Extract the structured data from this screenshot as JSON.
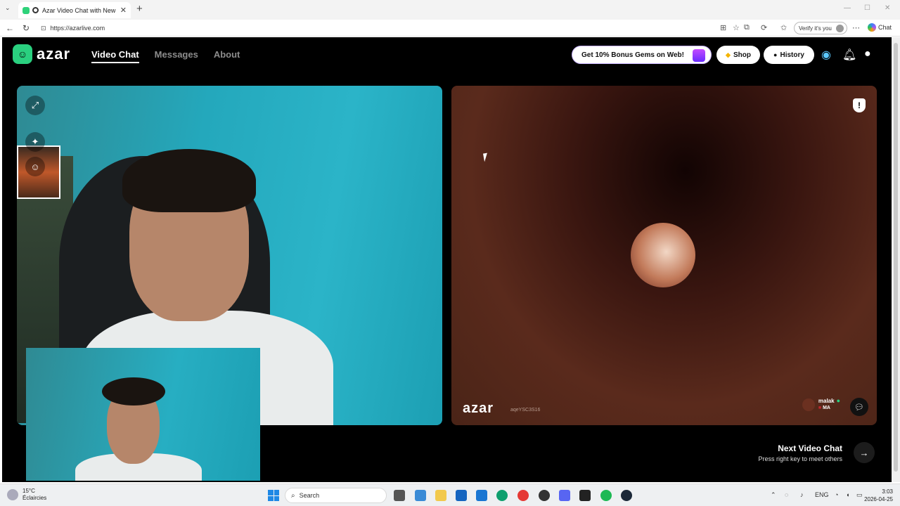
{
  "browser": {
    "tab_title": "Azar Video Chat with New Pe",
    "url": "https://azarlive.com",
    "verify_label": "Verify it's you",
    "copilot_label": "Chat"
  },
  "header": {
    "logo_text": "azar",
    "nav": [
      {
        "label": "Video Chat",
        "active": true
      },
      {
        "label": "Messages",
        "active": false
      },
      {
        "label": "About",
        "active": false
      }
    ],
    "promo_label": "Get 10% Bonus Gems on Web!",
    "shop_label": "Shop",
    "history_label": "History"
  },
  "remote": {
    "logo_text": "azar",
    "code": "aqeYSC3S16",
    "username": "malak",
    "country": "MA"
  },
  "next": {
    "title": "Next Video Chat",
    "subtitle": "Press right key to meet others"
  },
  "taskbar": {
    "temp": "15°C",
    "condition": "Éclaircies",
    "search_placeholder": "Search",
    "lang": "ENG",
    "time": "3:03",
    "date": "2026-04-25"
  },
  "colors": {
    "brand_green": "#2ad07f",
    "page_bg": "#000000"
  }
}
